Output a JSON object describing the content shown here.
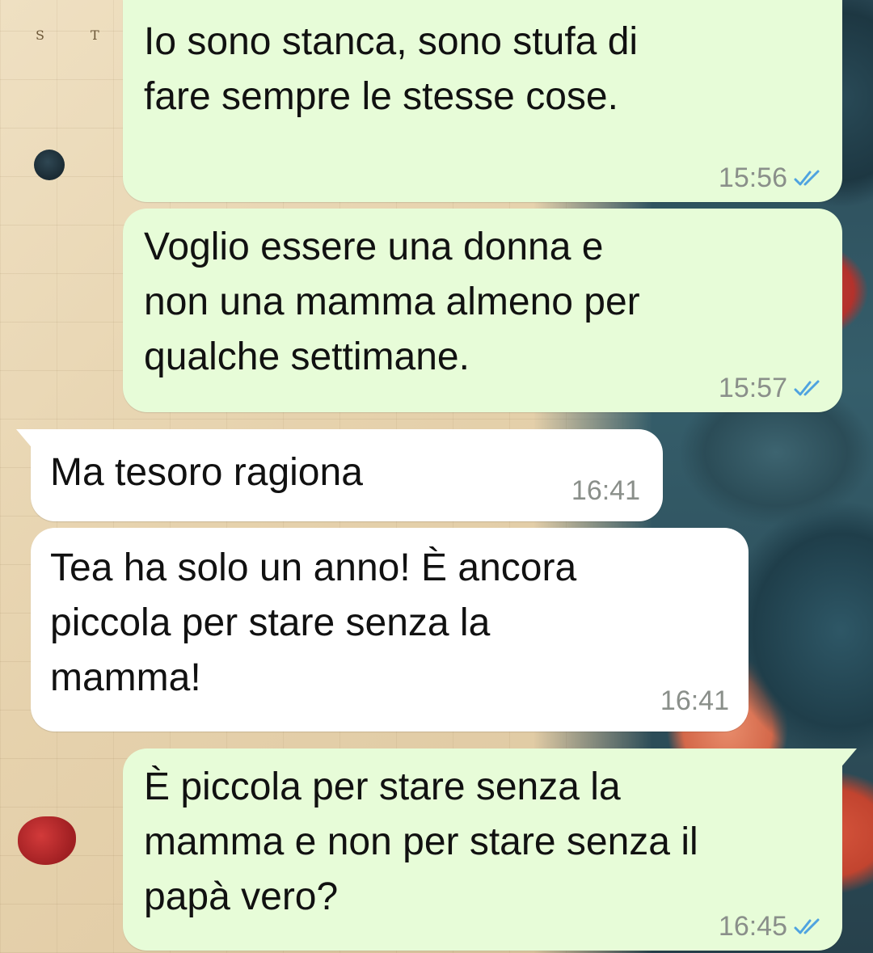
{
  "wallpaper": {
    "letters": [
      "S",
      "T"
    ]
  },
  "colors": {
    "outgoing_bubble": "#e7fcd8",
    "incoming_bubble": "#ffffff",
    "read_ticks": "#4fa3e0",
    "timestamp": "#8a8f8a"
  },
  "messages": [
    {
      "direction": "outgoing",
      "text": "Io sono stanca, sono stufa di\nfare sempre le stesse cose.",
      "time": "15:56",
      "status_icon": "double-check-read-icon"
    },
    {
      "direction": "outgoing",
      "text": "Voglio essere una donna e\nnon una mamma almeno per\nqualche settimane.",
      "time": "15:57",
      "status_icon": "double-check-read-icon"
    },
    {
      "direction": "incoming",
      "text": "Ma tesoro ragiona",
      "time": "16:41"
    },
    {
      "direction": "incoming",
      "text": "Tea ha solo un anno! È ancora\npiccola per stare senza la\nmamma!",
      "time": "16:41"
    },
    {
      "direction": "outgoing",
      "text": "È piccola per stare senza la\nmamma e non per stare senza il\npapà vero?",
      "time": "16:45",
      "status_icon": "double-check-read-icon"
    }
  ]
}
